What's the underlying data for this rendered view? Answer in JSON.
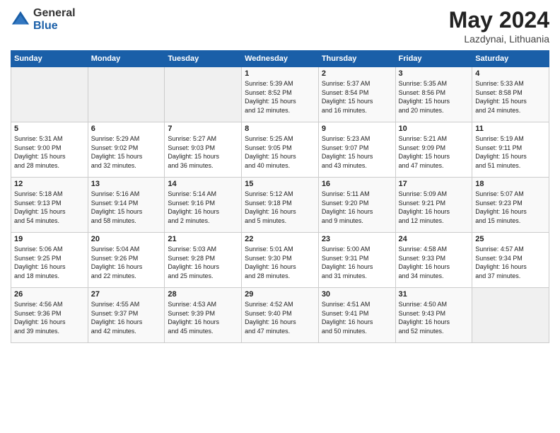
{
  "header": {
    "logo_general": "General",
    "logo_blue": "Blue",
    "title": "May 2024",
    "location": "Lazdynai, Lithuania"
  },
  "days_of_week": [
    "Sunday",
    "Monday",
    "Tuesday",
    "Wednesday",
    "Thursday",
    "Friday",
    "Saturday"
  ],
  "weeks": [
    [
      {
        "day": "",
        "info": ""
      },
      {
        "day": "",
        "info": ""
      },
      {
        "day": "",
        "info": ""
      },
      {
        "day": "1",
        "info": "Sunrise: 5:39 AM\nSunset: 8:52 PM\nDaylight: 15 hours\nand 12 minutes."
      },
      {
        "day": "2",
        "info": "Sunrise: 5:37 AM\nSunset: 8:54 PM\nDaylight: 15 hours\nand 16 minutes."
      },
      {
        "day": "3",
        "info": "Sunrise: 5:35 AM\nSunset: 8:56 PM\nDaylight: 15 hours\nand 20 minutes."
      },
      {
        "day": "4",
        "info": "Sunrise: 5:33 AM\nSunset: 8:58 PM\nDaylight: 15 hours\nand 24 minutes."
      }
    ],
    [
      {
        "day": "5",
        "info": "Sunrise: 5:31 AM\nSunset: 9:00 PM\nDaylight: 15 hours\nand 28 minutes."
      },
      {
        "day": "6",
        "info": "Sunrise: 5:29 AM\nSunset: 9:02 PM\nDaylight: 15 hours\nand 32 minutes."
      },
      {
        "day": "7",
        "info": "Sunrise: 5:27 AM\nSunset: 9:03 PM\nDaylight: 15 hours\nand 36 minutes."
      },
      {
        "day": "8",
        "info": "Sunrise: 5:25 AM\nSunset: 9:05 PM\nDaylight: 15 hours\nand 40 minutes."
      },
      {
        "day": "9",
        "info": "Sunrise: 5:23 AM\nSunset: 9:07 PM\nDaylight: 15 hours\nand 43 minutes."
      },
      {
        "day": "10",
        "info": "Sunrise: 5:21 AM\nSunset: 9:09 PM\nDaylight: 15 hours\nand 47 minutes."
      },
      {
        "day": "11",
        "info": "Sunrise: 5:19 AM\nSunset: 9:11 PM\nDaylight: 15 hours\nand 51 minutes."
      }
    ],
    [
      {
        "day": "12",
        "info": "Sunrise: 5:18 AM\nSunset: 9:13 PM\nDaylight: 15 hours\nand 54 minutes."
      },
      {
        "day": "13",
        "info": "Sunrise: 5:16 AM\nSunset: 9:14 PM\nDaylight: 15 hours\nand 58 minutes."
      },
      {
        "day": "14",
        "info": "Sunrise: 5:14 AM\nSunset: 9:16 PM\nDaylight: 16 hours\nand 2 minutes."
      },
      {
        "day": "15",
        "info": "Sunrise: 5:12 AM\nSunset: 9:18 PM\nDaylight: 16 hours\nand 5 minutes."
      },
      {
        "day": "16",
        "info": "Sunrise: 5:11 AM\nSunset: 9:20 PM\nDaylight: 16 hours\nand 9 minutes."
      },
      {
        "day": "17",
        "info": "Sunrise: 5:09 AM\nSunset: 9:21 PM\nDaylight: 16 hours\nand 12 minutes."
      },
      {
        "day": "18",
        "info": "Sunrise: 5:07 AM\nSunset: 9:23 PM\nDaylight: 16 hours\nand 15 minutes."
      }
    ],
    [
      {
        "day": "19",
        "info": "Sunrise: 5:06 AM\nSunset: 9:25 PM\nDaylight: 16 hours\nand 18 minutes."
      },
      {
        "day": "20",
        "info": "Sunrise: 5:04 AM\nSunset: 9:26 PM\nDaylight: 16 hours\nand 22 minutes."
      },
      {
        "day": "21",
        "info": "Sunrise: 5:03 AM\nSunset: 9:28 PM\nDaylight: 16 hours\nand 25 minutes."
      },
      {
        "day": "22",
        "info": "Sunrise: 5:01 AM\nSunset: 9:30 PM\nDaylight: 16 hours\nand 28 minutes."
      },
      {
        "day": "23",
        "info": "Sunrise: 5:00 AM\nSunset: 9:31 PM\nDaylight: 16 hours\nand 31 minutes."
      },
      {
        "day": "24",
        "info": "Sunrise: 4:58 AM\nSunset: 9:33 PM\nDaylight: 16 hours\nand 34 minutes."
      },
      {
        "day": "25",
        "info": "Sunrise: 4:57 AM\nSunset: 9:34 PM\nDaylight: 16 hours\nand 37 minutes."
      }
    ],
    [
      {
        "day": "26",
        "info": "Sunrise: 4:56 AM\nSunset: 9:36 PM\nDaylight: 16 hours\nand 39 minutes."
      },
      {
        "day": "27",
        "info": "Sunrise: 4:55 AM\nSunset: 9:37 PM\nDaylight: 16 hours\nand 42 minutes."
      },
      {
        "day": "28",
        "info": "Sunrise: 4:53 AM\nSunset: 9:39 PM\nDaylight: 16 hours\nand 45 minutes."
      },
      {
        "day": "29",
        "info": "Sunrise: 4:52 AM\nSunset: 9:40 PM\nDaylight: 16 hours\nand 47 minutes."
      },
      {
        "day": "30",
        "info": "Sunrise: 4:51 AM\nSunset: 9:41 PM\nDaylight: 16 hours\nand 50 minutes."
      },
      {
        "day": "31",
        "info": "Sunrise: 4:50 AM\nSunset: 9:43 PM\nDaylight: 16 hours\nand 52 minutes."
      },
      {
        "day": "",
        "info": ""
      }
    ]
  ]
}
